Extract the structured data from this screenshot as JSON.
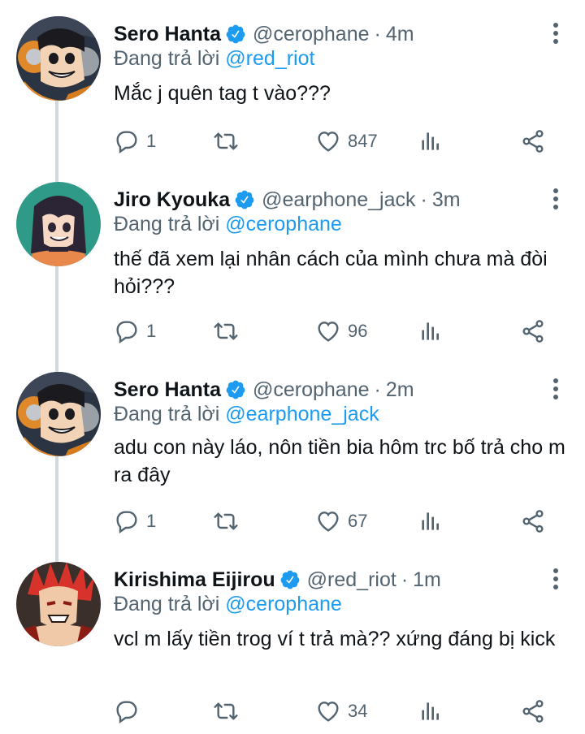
{
  "colors": {
    "text": "#0f1419",
    "secondary": "#536471",
    "accent": "#1d9bf0",
    "thread_line": "#cfd9de"
  },
  "tweets": [
    {
      "name": "Sero Hanta",
      "handle": "@cerophane",
      "separator": "·",
      "time": "4m",
      "replying_prefix": "Đang trả lời",
      "replying_to": "@red_riot",
      "text": "Mắc j quên tag t vào???",
      "replies": "1",
      "retweets": "",
      "likes": "847"
    },
    {
      "name": "Jiro Kyouka",
      "handle": "@earphone_jack",
      "separator": "·",
      "time": "3m",
      "replying_prefix": "Đang trả lời",
      "replying_to": "@cerophane",
      "text": "thế đã xem lại nhân cách của mình chưa mà đòi hỏi???",
      "replies": "1",
      "retweets": "",
      "likes": "96"
    },
    {
      "name": "Sero Hanta",
      "handle": "@cerophane",
      "separator": "·",
      "time": "2m",
      "replying_prefix": "Đang trả lời",
      "replying_to": "@earphone_jack",
      "text": "adu con này láo, nôn tiền bia hôm trc bố trả cho m ra đây",
      "replies": "1",
      "retweets": "",
      "likes": "67"
    },
    {
      "name": "Kirishima Eijirou",
      "handle": "@red_riot",
      "separator": "·",
      "time": "1m",
      "replying_prefix": "Đang trả lời",
      "replying_to": "@cerophane",
      "text": "vcl m lấy tiền trog ví t trả mà?? xứng đáng bị kick",
      "replies": "",
      "retweets": "",
      "likes": "34"
    }
  ]
}
